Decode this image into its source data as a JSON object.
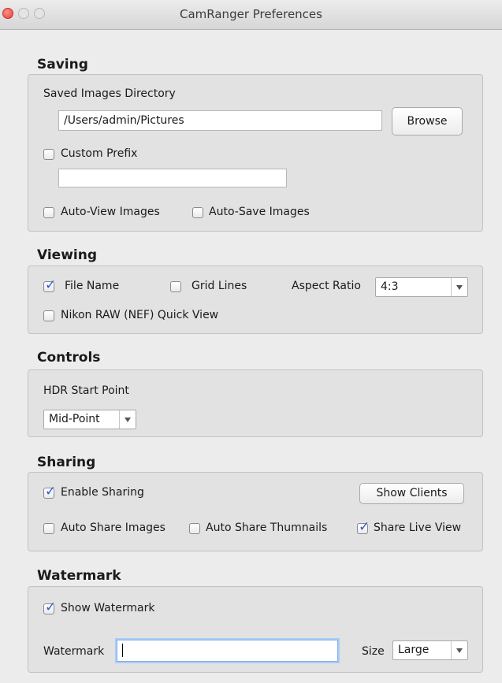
{
  "window": {
    "title": "CamRanger Preferences"
  },
  "saving": {
    "title": "Saving",
    "dir_label": "Saved Images Directory",
    "dir_value": "/Users/admin/Pictures",
    "browse_label": "Browse",
    "custom_prefix_label": "Custom Prefix",
    "custom_prefix_checked": false,
    "prefix_value": "",
    "auto_view_label": "Auto-View Images",
    "auto_view_checked": false,
    "auto_save_label": "Auto-Save Images",
    "auto_save_checked": false
  },
  "viewing": {
    "title": "Viewing",
    "file_name_label": "File Name",
    "file_name_checked": true,
    "grid_lines_label": "Grid Lines",
    "grid_lines_checked": false,
    "aspect_ratio_label": "Aspect Ratio",
    "aspect_ratio_value": "4:3",
    "nikon_label": "Nikon RAW (NEF) Quick View",
    "nikon_checked": false
  },
  "controls": {
    "title": "Controls",
    "hdr_label": "HDR Start Point",
    "hdr_value": "Mid-Point"
  },
  "sharing": {
    "title": "Sharing",
    "enable_label": "Enable Sharing",
    "enable_checked": true,
    "show_clients_label": "Show Clients",
    "auto_share_label": "Auto Share Images",
    "auto_share_checked": false,
    "auto_thumbs_label": "Auto Share Thumnails",
    "auto_thumbs_checked": false,
    "live_view_label": "Share Live View",
    "live_view_checked": true
  },
  "watermark": {
    "title": "Watermark",
    "show_label": "Show Watermark",
    "show_checked": true,
    "field_label": "Watermark",
    "field_value": "",
    "size_label": "Size",
    "size_value": "Large"
  },
  "colors": {
    "accent": "#2c5bd9",
    "focus_ring": "#a9cdf5",
    "close_button": "#e0443e"
  },
  "icons": {
    "check": "✓",
    "dropdown": "chevron-down"
  }
}
